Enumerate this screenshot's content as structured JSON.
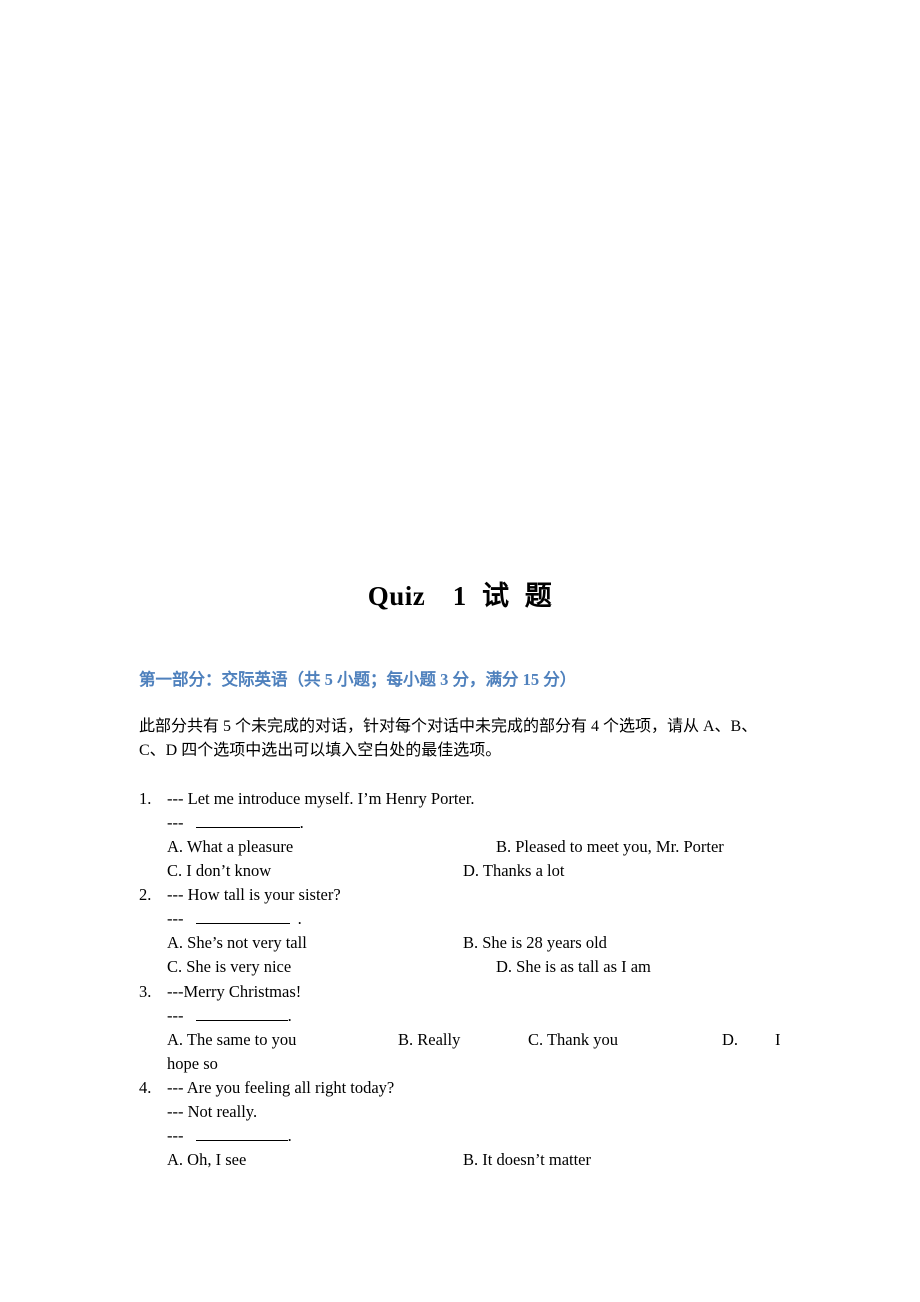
{
  "document": {
    "title": "Quiz　1 试 题",
    "section": {
      "heading": "第一部分：交际英语（共 5 小题；每小题 3 分，满分 15 分）",
      "heading_color": "#4f81bd",
      "instructions": [
        "此部分共有 5 个未完成的对话，针对每个对话中未完成的部分有 4 个选项，请从 A、B、",
        "C、D 四个选项中选出可以填入空白处的最佳选项。"
      ]
    },
    "questions": [
      {
        "number": "1.",
        "lines": [
          "--- Let me introduce myself. I’m Henry Porter."
        ],
        "answer_prefix": "---",
        "answer_suffix": ".",
        "options": {
          "A": "A. What a pleasure",
          "B": "B. Pleased to meet you, Mr. Porter",
          "C": "C. I don’t know",
          "D": "D. Thanks a lot"
        }
      },
      {
        "number": "2.",
        "lines": [
          "--- How tall is your sister?"
        ],
        "answer_prefix": "---",
        "answer_suffix": ".",
        "options": {
          "A": "A. She’s not very tall",
          "B": "B. She is 28 years old",
          "C": "C. She is very nice",
          "D": "D. She is as tall as I am"
        }
      },
      {
        "number": "3.",
        "lines": [
          "---Merry Christmas!"
        ],
        "answer_prefix": "---",
        "answer_suffix": ".",
        "options": {
          "A": "A. The same to you",
          "B": "B. Really",
          "C": "C. Thank you",
          "D_label": "D.",
          "D_first": "I",
          "D_rest": "hope so"
        }
      },
      {
        "number": "4.",
        "lines": [
          "--- Are you feeling all right today?",
          "--- Not really."
        ],
        "answer_prefix": "---",
        "answer_suffix": ".",
        "options": {
          "A": "A. Oh, I see",
          "B": "B. It doesn’t matter"
        }
      }
    ]
  }
}
